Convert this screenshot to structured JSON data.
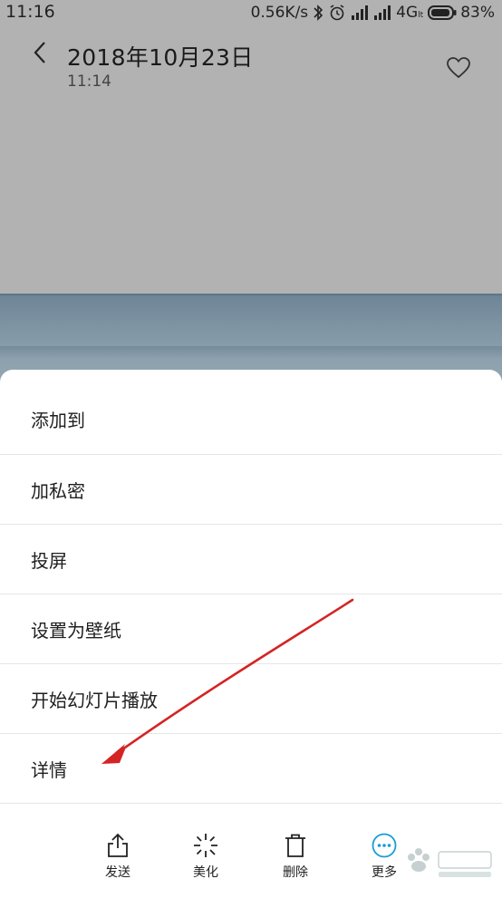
{
  "status_bar": {
    "time": "11:16",
    "speed": "0.56K/s",
    "network": "4G",
    "network_sub": "lt",
    "battery": "83%"
  },
  "header": {
    "title": "2018年10月23日",
    "subtitle": "11:14"
  },
  "menu": {
    "items": [
      {
        "label": "添加到"
      },
      {
        "label": "加私密"
      },
      {
        "label": "投屏"
      },
      {
        "label": "设置为壁纸"
      },
      {
        "label": "开始幻灯片播放"
      },
      {
        "label": "详情"
      }
    ]
  },
  "toolbar": {
    "send_label": "发送",
    "beautify_label": "美化",
    "delete_label": "删除",
    "more_label": "更多"
  },
  "colors": {
    "accent": "#1a9bd8",
    "annotation": "#d42424",
    "overlay": "#b3b3b3"
  },
  "icons": [
    "back-icon",
    "heart-icon",
    "bluetooth-icon",
    "alarm-icon",
    "signal-icon",
    "battery-icon",
    "share-icon",
    "magic-wand-icon",
    "trash-icon",
    "more-icon"
  ]
}
